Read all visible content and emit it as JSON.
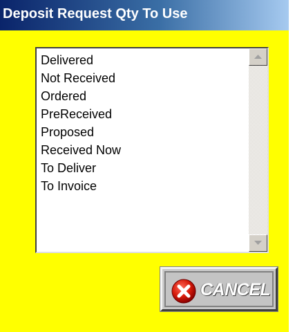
{
  "window": {
    "title": "Deposit Request Qty To Use"
  },
  "list": {
    "items": [
      "Delivered",
      "Not Received",
      "Ordered",
      "PreReceived",
      "Proposed",
      "Received Now",
      "To Deliver",
      "To Invoice"
    ]
  },
  "scrollbar": {
    "up_icon": "arrow-up-icon",
    "down_icon": "arrow-down-icon"
  },
  "buttons": {
    "cancel_label": "CANCEL",
    "cancel_icon": "x-circle-icon"
  },
  "colors": {
    "background": "#ffff00",
    "titlebar_start": "#0a246a",
    "titlebar_end": "#a6caf0",
    "cancel_icon": "#cc0000"
  }
}
